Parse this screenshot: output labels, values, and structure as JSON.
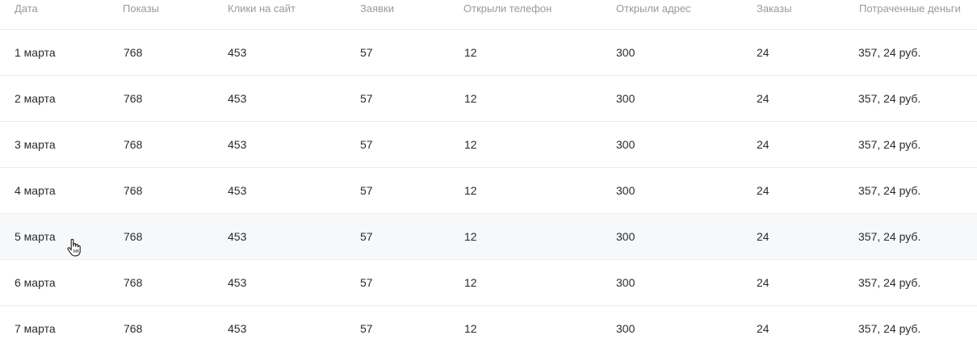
{
  "table": {
    "columns": [
      "Дата",
      "Показы",
      "Клики на сайт",
      "Заявки",
      "Открыли телефон",
      "Открыли адрес",
      "Заказы",
      "Потраченные деньги"
    ],
    "rows": [
      {
        "date": "1 марта",
        "shows": "768",
        "clicks": "453",
        "requests": "57",
        "phone": "12",
        "address": "300",
        "orders": "24",
        "spent": "357, 24 руб."
      },
      {
        "date": "2 марта",
        "shows": "768",
        "clicks": "453",
        "requests": "57",
        "phone": "12",
        "address": "300",
        "orders": "24",
        "spent": "357, 24 руб."
      },
      {
        "date": "3 марта",
        "shows": "768",
        "clicks": "453",
        "requests": "57",
        "phone": "12",
        "address": "300",
        "orders": "24",
        "spent": "357, 24 руб."
      },
      {
        "date": "4 марта",
        "shows": "768",
        "clicks": "453",
        "requests": "57",
        "phone": "12",
        "address": "300",
        "orders": "24",
        "spent": "357, 24 руб."
      },
      {
        "date": "5 марта",
        "shows": "768",
        "clicks": "453",
        "requests": "57",
        "phone": "12",
        "address": "300",
        "orders": "24",
        "spent": "357, 24 руб."
      },
      {
        "date": "6 марта",
        "shows": "768",
        "clicks": "453",
        "requests": "57",
        "phone": "12",
        "address": "300",
        "orders": "24",
        "spent": "357, 24 руб."
      },
      {
        "date": "7 марта",
        "shows": "768",
        "clicks": "453",
        "requests": "57",
        "phone": "12",
        "address": "300",
        "orders": "24",
        "spent": "357, 24 руб."
      }
    ],
    "hovered_row_index": 4
  },
  "colors": {
    "header_text": "#9a9a9a",
    "cell_text": "#2b2b2b",
    "row_divider": "#ececec",
    "hover_background": "#f7f8fa"
  },
  "icons": {
    "cursor": "hand-pointer-icon"
  }
}
